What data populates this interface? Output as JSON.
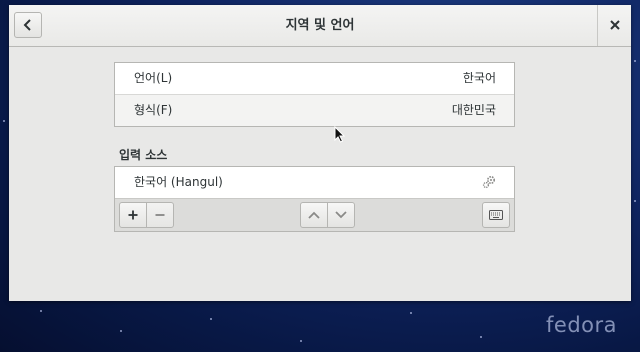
{
  "window": {
    "title": "지역 및 언어"
  },
  "language_format": {
    "rows": [
      {
        "label": "언어(L)",
        "value": "한국어"
      },
      {
        "label": "형식(F)",
        "value": "대한민국"
      }
    ]
  },
  "input_sources": {
    "heading": "입력 소스",
    "items": [
      {
        "label": "한국어 (Hangul)",
        "icon": "gear-icon"
      }
    ],
    "toolbar": {
      "add_icon": "plus-icon",
      "remove_icon": "minus-icon",
      "up_icon": "chevron-up-icon",
      "down_icon": "chevron-down-icon",
      "keyboard_icon": "keyboard-icon"
    }
  },
  "desktop": {
    "logo_text": "fedora"
  },
  "colors": {
    "window_bg": "#e8e8e7",
    "desktop_bg": "#0f2460",
    "text": "#2e3436"
  }
}
